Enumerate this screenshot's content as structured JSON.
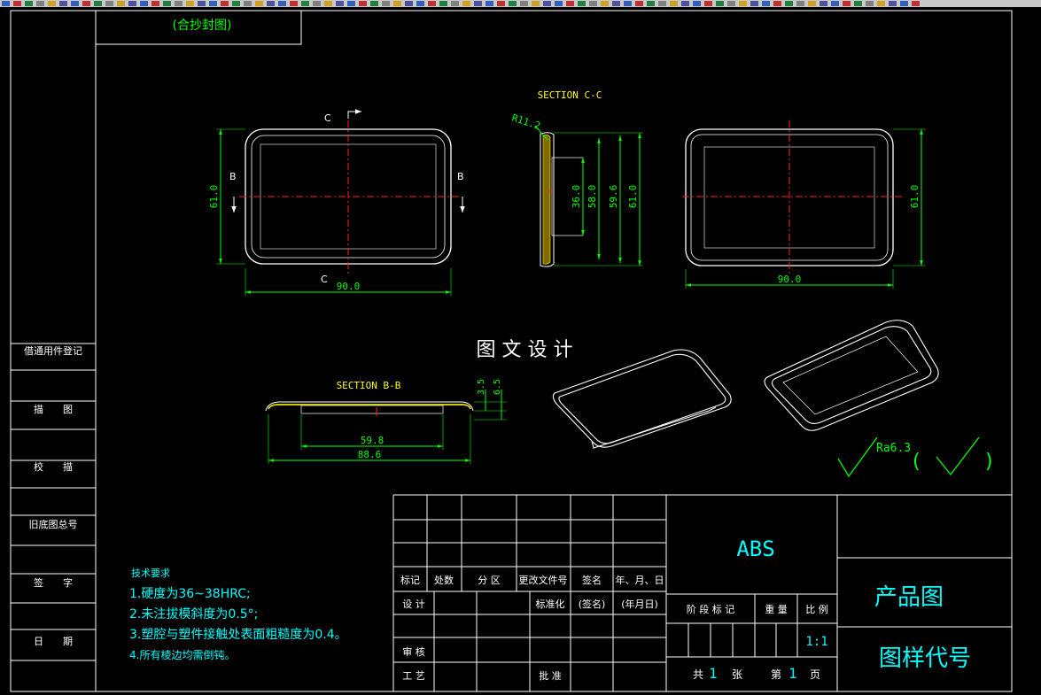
{
  "app": {
    "toolbar_icons": [
      "layer-icon",
      "layer-icon",
      "layer-icon",
      "layer-icon",
      "layer-icon",
      "layer-icon",
      "layer-icon",
      "layer-icon",
      "layer-icon",
      "layer-icon",
      "layer-icon",
      "layer-icon",
      "layer-icon",
      "layer-icon",
      "layer-icon",
      "layer-icon",
      "layer-icon",
      "layer-icon",
      "layer-icon",
      "layer-icon",
      "layer-icon",
      "layer-icon",
      "layer-icon",
      "layer-icon",
      "layer-icon",
      "layer-icon",
      "layer-icon",
      "layer-icon",
      "layer-icon",
      "layer-icon",
      "layer-icon",
      "layer-icon",
      "layer-icon",
      "layer-icon",
      "layer-icon",
      "layer-icon",
      "layer-icon",
      "layer-icon",
      "layer-icon",
      "layer-icon",
      "layer-icon",
      "layer-icon",
      "layer-icon",
      "layer-icon",
      "layer-icon",
      "layer-icon",
      "layer-icon",
      "layer-icon",
      "layer-icon",
      "layer-icon",
      "layer-icon",
      "layer-icon",
      "layer-icon",
      "layer-icon",
      "layer-icon",
      "layer-icon",
      "layer-icon",
      "layer-icon",
      "layer-icon",
      "layer-icon",
      "layer-icon",
      "layer-icon",
      "layer-icon",
      "layer-icon",
      "layer-icon",
      "layer-icon",
      "layer-icon",
      "layer-icon",
      "layer-icon",
      "layer-icon",
      "layer-icon",
      "layer-icon",
      "layer-icon",
      "layer-icon",
      "layer-icon",
      "layer-icon",
      "layer-icon",
      "layer-icon",
      "layer-icon",
      "layer-icon"
    ]
  },
  "colors": {
    "background": "#000000",
    "frame": "#ffffff",
    "dimension": "#00ff00",
    "centerline": "#ff2020",
    "label_yellow": "#ffff00",
    "cyan": "#00ffff",
    "toolbar": "#c8c8c8"
  },
  "top_stamp": {
    "text": "(合抄封图)"
  },
  "views": {
    "front": {
      "section_marks": {
        "top": "C",
        "bottom": "C",
        "left": "B",
        "right": "B"
      },
      "dim_height": "61.0",
      "dim_width": "90.0"
    },
    "section_cc": {
      "title": "SECTION C-C",
      "radius": "R11.2",
      "dims": [
        "36.0",
        "58.0",
        "59.6",
        "61.0"
      ]
    },
    "back": {
      "dim_height": "61.0",
      "dim_width": "90.0"
    },
    "section_bb": {
      "title": "SECTION B-B",
      "dims_vertical": [
        "3.5",
        "6.5"
      ],
      "dim_inner": "59.8",
      "dim_outer": "88.6"
    }
  },
  "watermark": "图 文 设 计",
  "roughness": {
    "label": "Ra6.3",
    "paren_open": "(",
    "paren_close": ")"
  },
  "left_strip": {
    "cells": [
      "借通用件登记",
      "描　　图",
      "校　　描",
      "旧底图总号",
      "签　　字",
      "日　　期"
    ]
  },
  "tech_requirements": {
    "title": "技术要求",
    "items": [
      "1.硬度为36~38HRC;",
      "2.未注拔模斜度为0.5°;",
      "3.塑腔与塑件接触处表面粗糙度为0.4。",
      "4.所有棱边均需倒钝。"
    ]
  },
  "title_block": {
    "material": "ABS",
    "drawing_name": "产品图",
    "drawing_code": "图样代号",
    "header": [
      "标记",
      "处数",
      "分 区",
      "更改文件号",
      "签名",
      "年、月、日"
    ],
    "row_design": {
      "design": "设 计",
      "standard": "标准化",
      "sign": "(签名)",
      "date": "(年月日)"
    },
    "audit": "审 核",
    "process": "工 艺",
    "approve": "批 准",
    "stage": {
      "stage_mark": "阶 段 标 记",
      "weight": "重 量",
      "scale": "比 例",
      "scale_value": "1:1"
    },
    "sheets": {
      "total_label": "共",
      "total": "1",
      "sheet_unit": "张",
      "nth_label": "第",
      "nth": "1",
      "page_unit": "页"
    }
  }
}
